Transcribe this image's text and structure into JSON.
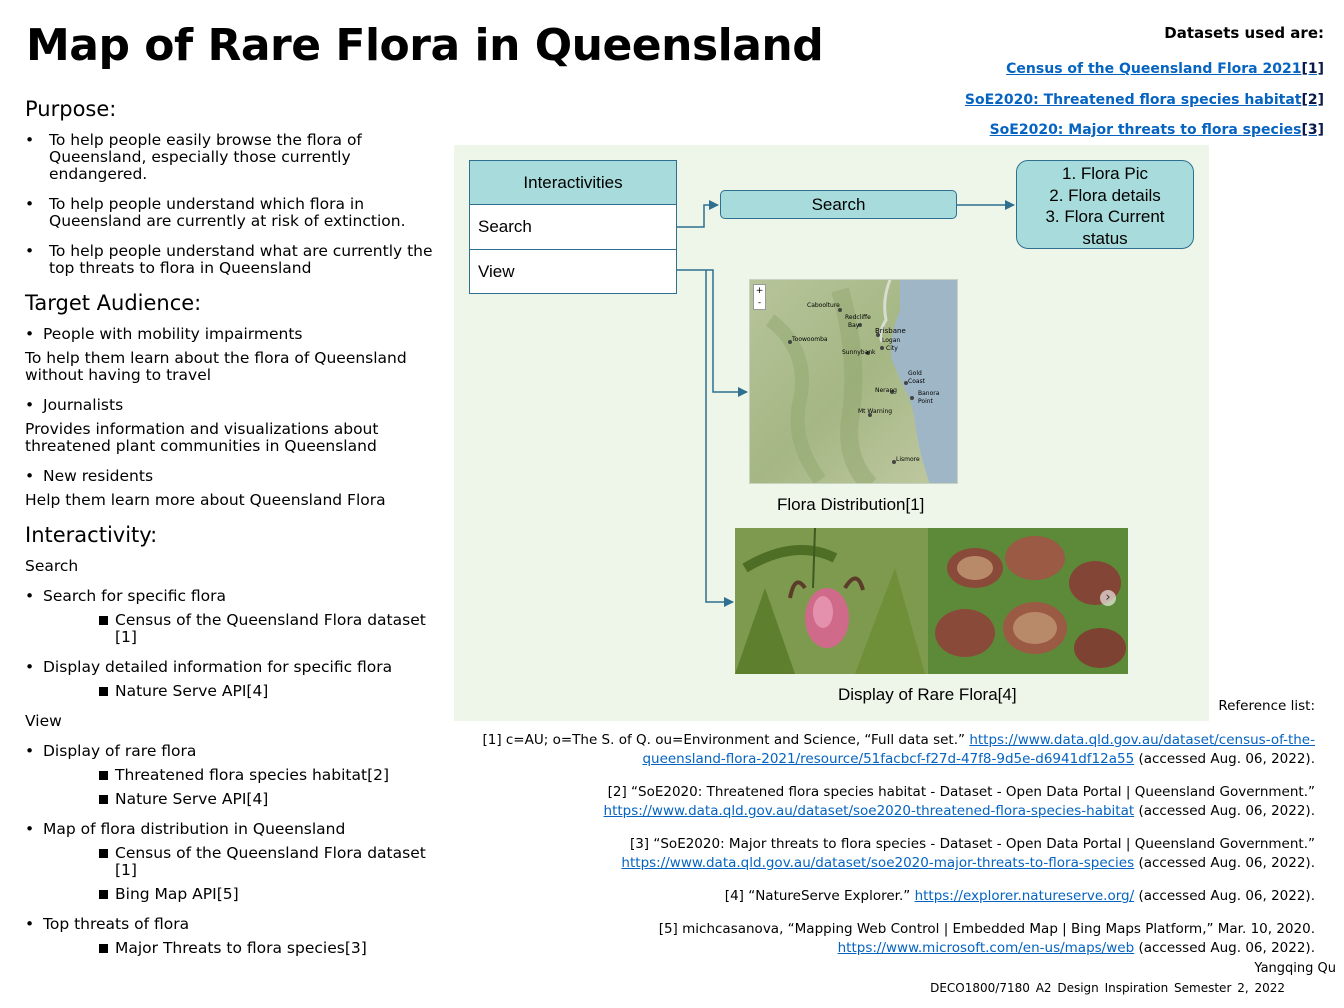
{
  "title": "Map of Rare Flora in Queensland",
  "datasets": {
    "heading": "Datasets used are:",
    "items": [
      {
        "label": "Census of the Queensland Flora 2021",
        "ref": "[1]"
      },
      {
        "label": "SoE2020: Threatened flora species habitat",
        "ref": "[2]"
      },
      {
        "label": "SoE2020: Major threats to flora species",
        "ref": "[3]"
      }
    ]
  },
  "purpose": {
    "heading": "Purpose:",
    "items": [
      "To help people easily browse the flora of Queensland, especially those currently endangered.",
      "To help people understand which flora in Queensland are currently at risk of extinction.",
      "To help people understand what are currently the top threats to flora in Queensland"
    ]
  },
  "audience": {
    "heading": "Target Audience:",
    "groups": [
      {
        "name": "People with mobility impairments",
        "desc": "To help them learn about the flora of Queensland without having to travel"
      },
      {
        "name": "Journalists",
        "desc": "Provides information and visualizations about threatened plant communities in Queensland"
      },
      {
        "name": "New residents",
        "desc": "Help them learn more about Queensland Flora"
      }
    ]
  },
  "interactivity": {
    "heading": "Interactivity:",
    "search_label": "Search",
    "view_label": "View",
    "search_items": [
      {
        "label": "Search for specific flora",
        "subs": [
          "Census of the Queensland Flora dataset [1]"
        ]
      },
      {
        "label": "Display detailed information for specific flora",
        "subs": [
          "Nature Serve API[4]"
        ]
      }
    ],
    "view_items": [
      {
        "label": "Display of rare flora",
        "subs": [
          "Threatened flora species habitat[2]",
          "Nature Serve API[4]"
        ]
      },
      {
        "label": "Map of flora distribution in Queensland",
        "subs": [
          "Census of the Queensland Flora dataset [1]",
          "Bing Map API[5]"
        ]
      },
      {
        "label": "Top threats of flora",
        "subs": [
          "Major Threats to flora species[3]"
        ]
      }
    ]
  },
  "diagram": {
    "table_header": "Interactivities",
    "row_search": "Search",
    "row_view": "View",
    "search_box": "Search",
    "info_lines": [
      "1. Flora Pic",
      "2. Flora details",
      "3. Flora Current",
      "status"
    ],
    "map_caption": "Flora Distribution[1]",
    "photo_caption": "Display of Rare Flora[4]",
    "map_places": [
      "Caboolture",
      "Redcliffe",
      "Bay",
      "Brisbane",
      "Logan",
      "City",
      "Toowoomba",
      "Sunnybank",
      "Gold",
      "Coast",
      "Nerang",
      "Banora",
      "Point",
      "Mt Warning",
      "Lismore"
    ],
    "zoom_in": "+",
    "zoom_out": "-",
    "photo_next": "›"
  },
  "references": {
    "heading": "Reference list:",
    "items": [
      {
        "pre": "[1] c=AU; o=The S. of Q. ou=Environment and Science, “Full data set.”",
        "url": "https://www.data.qld.gov.au/dataset/census-of-the-queensland-flora-2021/resource/51facbcf-f27d-47f8-9d5e-d6941df12a55",
        "post": "(accessed Aug. 06, 2022)."
      },
      {
        "pre": "[2] “SoE2020: Threatened flora species habitat - Dataset - Open Data Portal | Queensland Government.”",
        "url": "https://www.data.qld.gov.au/dataset/soe2020-threatened-flora-species-habitat",
        "post": "(accessed Aug. 06, 2022)."
      },
      {
        "pre": "[3] “SoE2020: Major threats to flora species - Dataset - Open Data Portal | Queensland Government.”",
        "url": "https://www.data.qld.gov.au/dataset/soe2020-major-threats-to-flora-species",
        "post": "(accessed Aug. 06, 2022)."
      },
      {
        "pre": "[4] “NatureServe Explorer.”",
        "url": "https://explorer.natureserve.org/",
        "post": "(accessed Aug. 06, 2022)."
      },
      {
        "pre": "[5] michcasanova, “Mapping Web Control | Embedded Map | Bing Maps Platform,” Mar. 10, 2020.",
        "url": "https://www.microsoft.com/en-us/maps/web",
        "post": "(accessed Aug. 06, 2022)."
      }
    ]
  },
  "author": "Yangqing Qu",
  "course": "DECO1800/7180 A2 Design Inspiration Semester 2, 2022"
}
